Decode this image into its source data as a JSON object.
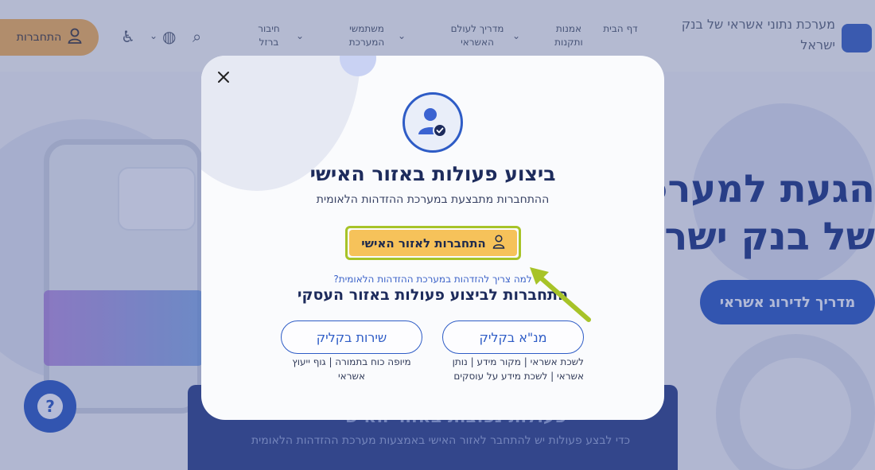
{
  "background": {
    "brand": "מערכת נתוני אשראי של בנק ישראל",
    "nav_items": [
      "דף הבית",
      "אמנות ותקנות",
      "מדריך לעולם האשראי",
      "משתמשי המערכת",
      "חיבור ברזל"
    ],
    "login_label": "התחברות",
    "hero_title_line1": "הגעת למערכ",
    "hero_title_line2": "של בנק ישרא",
    "hero_button": "מדריך לדירוג אשראי",
    "panel_title": "פעולות נפוצות באזור האישי",
    "panel_subtitle": "כדי לבצע פעולות יש להתחבר לאזור האישי באמצעות מערכת ההזדהות הלאומית",
    "help_glyph": "?"
  },
  "modal": {
    "title": "ביצוע פעולות באזור האישי",
    "subtitle": "ההתחברות מתבצעת במערכת ההזדהות הלאומית",
    "primary_button": "התחברות לאזור האישי",
    "why_link": "למה צריך להזדהות במערכת ההזדהות הלאומית?",
    "business_title": "התחברות לביצוע פעולות באזור העסקי",
    "option_right": {
      "label": "מנ\"א בקליק",
      "description": "לשכת אשראי | מקור מידע | נותן אשראי | לשכת מידע על עוסקים"
    },
    "option_left": {
      "label": "שירות בקליק",
      "description": "מיופה כוח בתמורה | גוף ייעוץ אשראי"
    },
    "close_icon": "close-icon"
  },
  "colors": {
    "accent": "#2e5cc6",
    "primary_button": "#f6c25a",
    "highlight": "#a7c328"
  }
}
